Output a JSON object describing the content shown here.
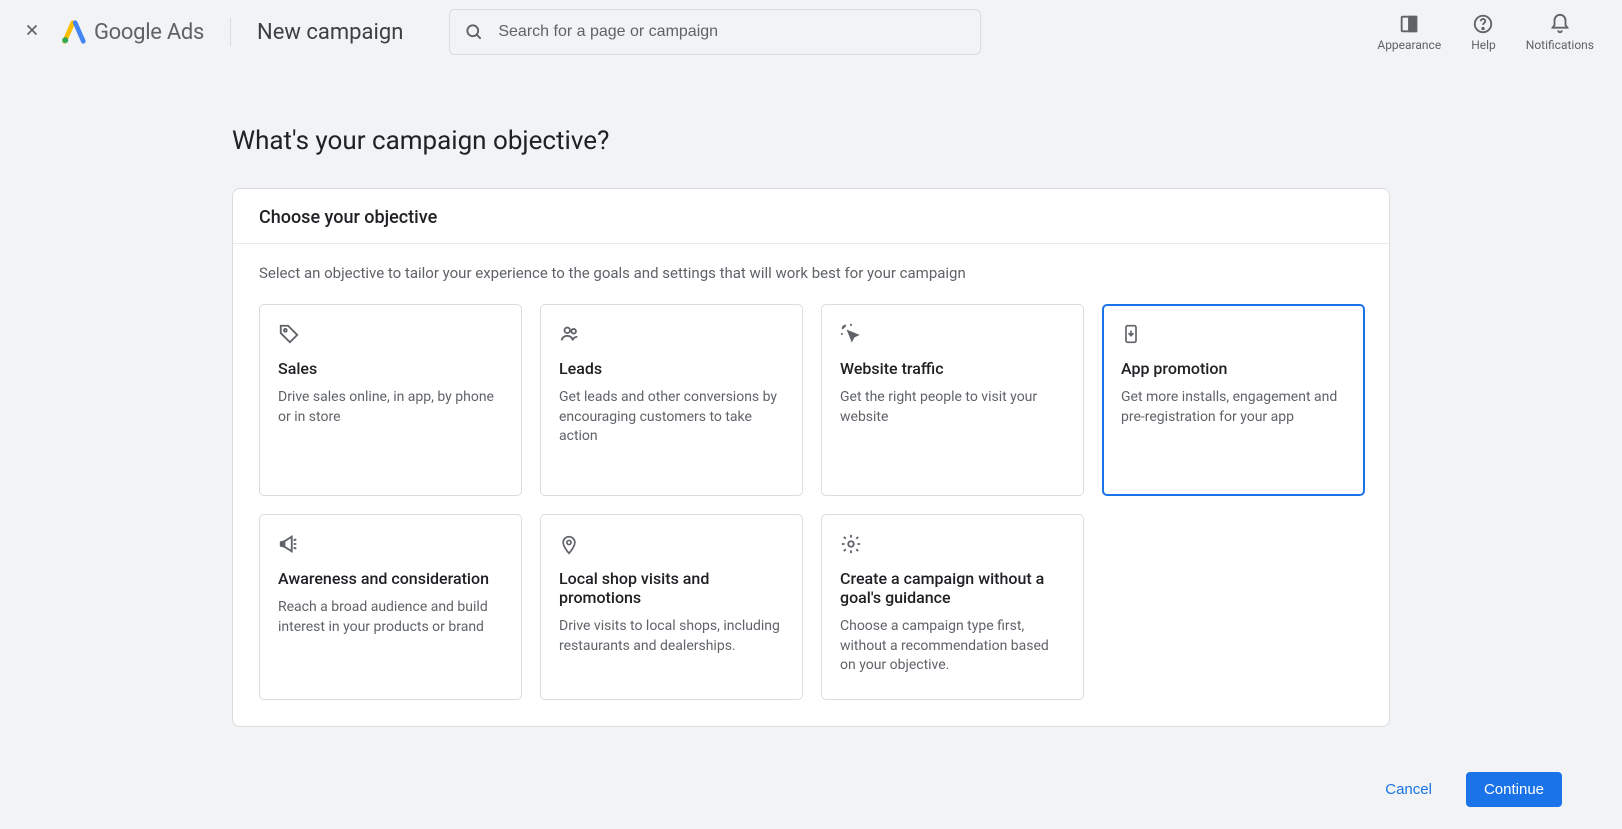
{
  "header": {
    "brand": "Google",
    "product": "Ads",
    "page_title": "New campaign",
    "search_placeholder": "Search for a page or campaign",
    "actions": {
      "appearance": "Appearance",
      "help": "Help",
      "notifications": "Notifications"
    }
  },
  "main": {
    "question": "What's your campaign objective?",
    "panel_title": "Choose your objective",
    "panel_subtitle": "Select an objective to tailor your experience to the goals and settings that will work best for your campaign",
    "selected_index": 3,
    "objectives": [
      {
        "id": "sales",
        "title": "Sales",
        "desc": "Drive sales online, in app, by phone or in store",
        "icon": "tag-icon"
      },
      {
        "id": "leads",
        "title": "Leads",
        "desc": "Get leads and other conversions by encouraging customers to take action",
        "icon": "people-icon"
      },
      {
        "id": "website-traffic",
        "title": "Website traffic",
        "desc": "Get the right people to visit your website",
        "icon": "cursor-click-icon"
      },
      {
        "id": "app-promotion",
        "title": "App promotion",
        "desc": "Get more installs, engagement and pre-registration for your app",
        "icon": "phone-download-icon"
      },
      {
        "id": "awareness",
        "title": "Awareness and consideration",
        "desc": "Reach a broad audience and build interest in your products or brand",
        "icon": "megaphone-icon"
      },
      {
        "id": "local",
        "title": "Local shop visits and promotions",
        "desc": "Drive visits to local shops, including restaurants and dealerships.",
        "icon": "pin-icon"
      },
      {
        "id": "no-goal",
        "title": "Create a campaign without a goal's guidance",
        "desc": "Choose a campaign type first, without a recommendation based on your objective.",
        "icon": "gear-icon"
      }
    ]
  },
  "footer": {
    "cancel": "Cancel",
    "continue": "Continue"
  }
}
